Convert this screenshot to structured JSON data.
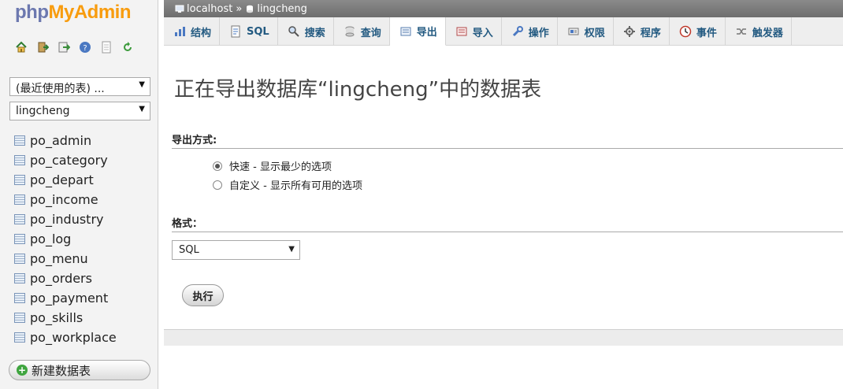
{
  "app": {
    "logo_php": "php",
    "logo_myadmin": "MyAdmin"
  },
  "nav": {
    "icons": [
      "home-icon",
      "exit-icon",
      "sql-query-icon",
      "help-icon",
      "docs-icon",
      "reload-icon"
    ],
    "recent_select": "(最近使用的表) ...",
    "db_select": "lingcheng",
    "tables": [
      "po_admin",
      "po_category",
      "po_depart",
      "po_income",
      "po_industry",
      "po_log",
      "po_menu",
      "po_orders",
      "po_payment",
      "po_skills",
      "po_workplace"
    ],
    "new_table": "新建数据表"
  },
  "breadcrumb": {
    "server": "localhost",
    "separator": "»",
    "database": "lingcheng"
  },
  "tabs": [
    {
      "label": "结构",
      "icon": "structure-icon"
    },
    {
      "label": "SQL",
      "icon": "sql-icon"
    },
    {
      "label": "搜索",
      "icon": "search-icon"
    },
    {
      "label": "查询",
      "icon": "query-icon"
    },
    {
      "label": "导出",
      "icon": "export-icon",
      "active": true
    },
    {
      "label": "导入",
      "icon": "import-icon"
    },
    {
      "label": "操作",
      "icon": "wrench-icon"
    },
    {
      "label": "权限",
      "icon": "privileges-icon"
    },
    {
      "label": "程序",
      "icon": "routines-icon"
    },
    {
      "label": "事件",
      "icon": "events-icon"
    },
    {
      "label": "触发器",
      "icon": "triggers-icon"
    }
  ],
  "main": {
    "title": "正在导出数据库“lingcheng”中的数据表",
    "method_heading": "导出方式:",
    "method_options": [
      {
        "label": "快速 - 显示最少的选项",
        "checked": true
      },
      {
        "label": "自定义 - 显示所有可用的选项",
        "checked": false
      }
    ],
    "format_heading": "格式：",
    "format_value": "SQL",
    "go_label": "执行"
  },
  "colors": {
    "tab_text": "#235a81",
    "logo_php": "#6c78af",
    "logo_myadmin": "#f89c0e"
  }
}
